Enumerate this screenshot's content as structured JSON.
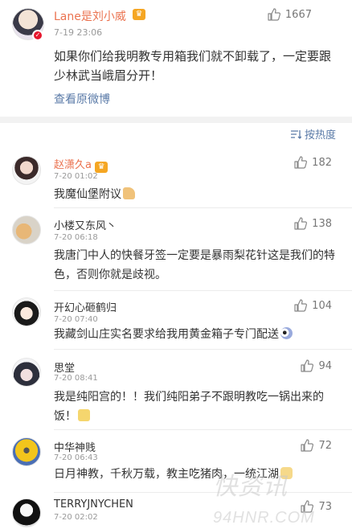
{
  "colors": {
    "accent": "#eb7350",
    "link": "#5b7ba8",
    "muted": "#999999",
    "verify_badge": "#e6162d",
    "crown": "#f5a623"
  },
  "post": {
    "author": "Lane是刘小威",
    "time": "7-19 23:06",
    "likes": "1667",
    "text": "如果你们给我明教专用箱我们就不卸载了，一定要跟少林武当峨眉分开！",
    "view_original": "查看原微博",
    "icons": [
      "verified-badge-icon",
      "crown-icon",
      "thumbs-up-icon"
    ]
  },
  "sort": {
    "label": "按热度",
    "icon": "sort-icon"
  },
  "comments": [
    {
      "name": "赵潇久a",
      "vip": true,
      "time": "7-20 01:02",
      "likes": "182",
      "text": "我魔仙堡附议"
    },
    {
      "name": "小楼又东风丶",
      "vip": false,
      "time": "7-20 06:18",
      "likes": "138",
      "text": "我唐门中人的快餐牙签一定要是暴雨梨花针这是我们的特色，否则你就是歧视。"
    },
    {
      "name": "开幻心砸鹤归",
      "vip": false,
      "time": "7-20 07:40",
      "likes": "104",
      "text": "我藏剑山庄实名要求给我用黄金箱子专门配送"
    },
    {
      "name": "思堂",
      "vip": false,
      "time": "7-20 08:41",
      "likes": "94",
      "text": "我是纯阳宫的！！我们纯阳弟子不跟明教吃一锅出来的饭！"
    },
    {
      "name": "中华神贱",
      "vip": false,
      "time": "7-20 06:43",
      "likes": "72",
      "text": "日月神教，千秋万载，教主吃猪肉，一统江湖"
    },
    {
      "name": "TERRYJNYCHEN",
      "vip": false,
      "time": "7-20 02:02",
      "likes": "73",
      "text": ""
    }
  ],
  "watermark": {
    "main": "快资讯",
    "sub": "94HNR.COM"
  }
}
